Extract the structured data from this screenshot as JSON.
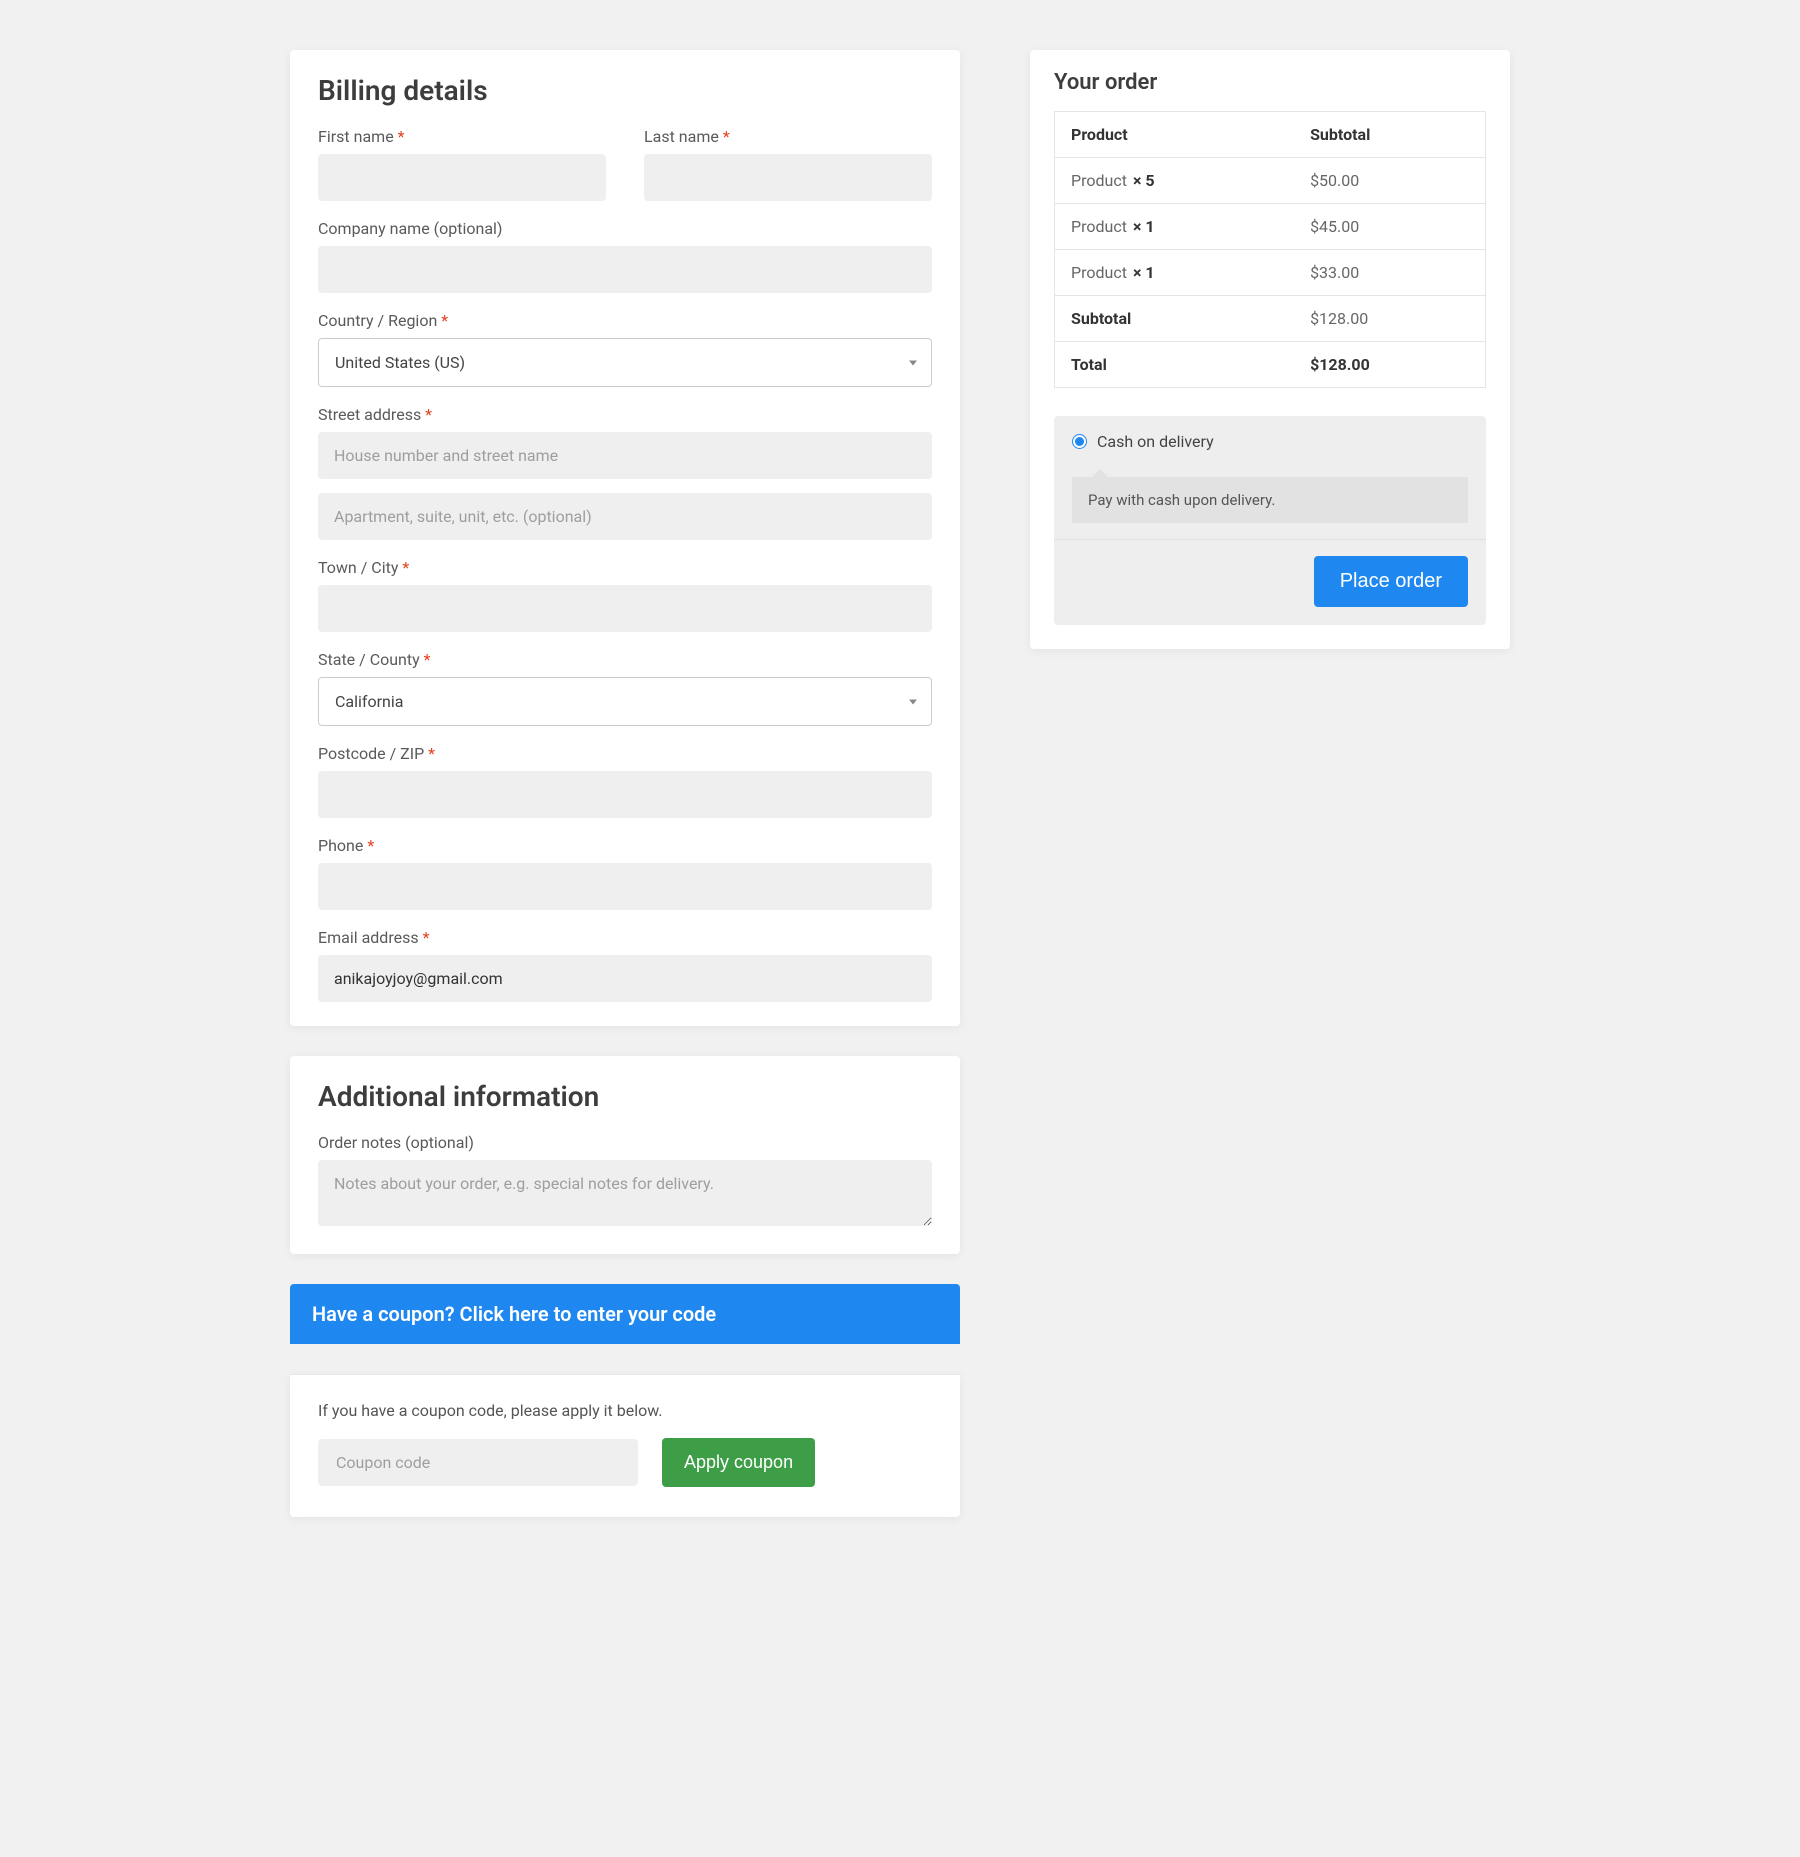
{
  "billing": {
    "heading": "Billing details",
    "first_name": {
      "label": "First name",
      "value": ""
    },
    "last_name": {
      "label": "Last name",
      "value": ""
    },
    "company": {
      "label": "Company name (optional)",
      "value": ""
    },
    "country": {
      "label": "Country / Region",
      "value": "United States (US)"
    },
    "street": {
      "label": "Street address",
      "placeholder1": "House number and street name",
      "placeholder2": "Apartment, suite, unit, etc. (optional)",
      "value1": "",
      "value2": ""
    },
    "city": {
      "label": "Town / City",
      "value": ""
    },
    "state": {
      "label": "State / County",
      "value": "California"
    },
    "postcode": {
      "label": "Postcode / ZIP",
      "value": ""
    },
    "phone": {
      "label": "Phone",
      "value": ""
    },
    "email": {
      "label": "Email address",
      "value": "anikajoyjoy@gmail.com"
    }
  },
  "additional": {
    "heading": "Additional information",
    "notes": {
      "label": "Order notes (optional)",
      "placeholder": "Notes about your order, e.g. special notes for delivery.",
      "value": ""
    }
  },
  "coupon": {
    "banner": "Have a coupon? Click here to enter your code",
    "hint": "If you have a coupon code, please apply it below.",
    "placeholder": "Coupon code",
    "button": "Apply coupon"
  },
  "order": {
    "heading": "Your order",
    "columns": {
      "product": "Product",
      "subtotal": "Subtotal"
    },
    "items": [
      {
        "name": "Product",
        "qty": "× 5",
        "subtotal": "$50.00"
      },
      {
        "name": "Product",
        "qty": "× 1",
        "subtotal": "$45.00"
      },
      {
        "name": "Product",
        "qty": "× 1",
        "subtotal": "$33.00"
      }
    ],
    "subtotal_label": "Subtotal",
    "subtotal_value": "$128.00",
    "total_label": "Total",
    "total_value": "$128.00"
  },
  "payment": {
    "cod_label": "Cash on delivery",
    "cod_desc": "Pay with cash upon delivery.",
    "place_order": "Place order"
  },
  "required_marker": "*"
}
